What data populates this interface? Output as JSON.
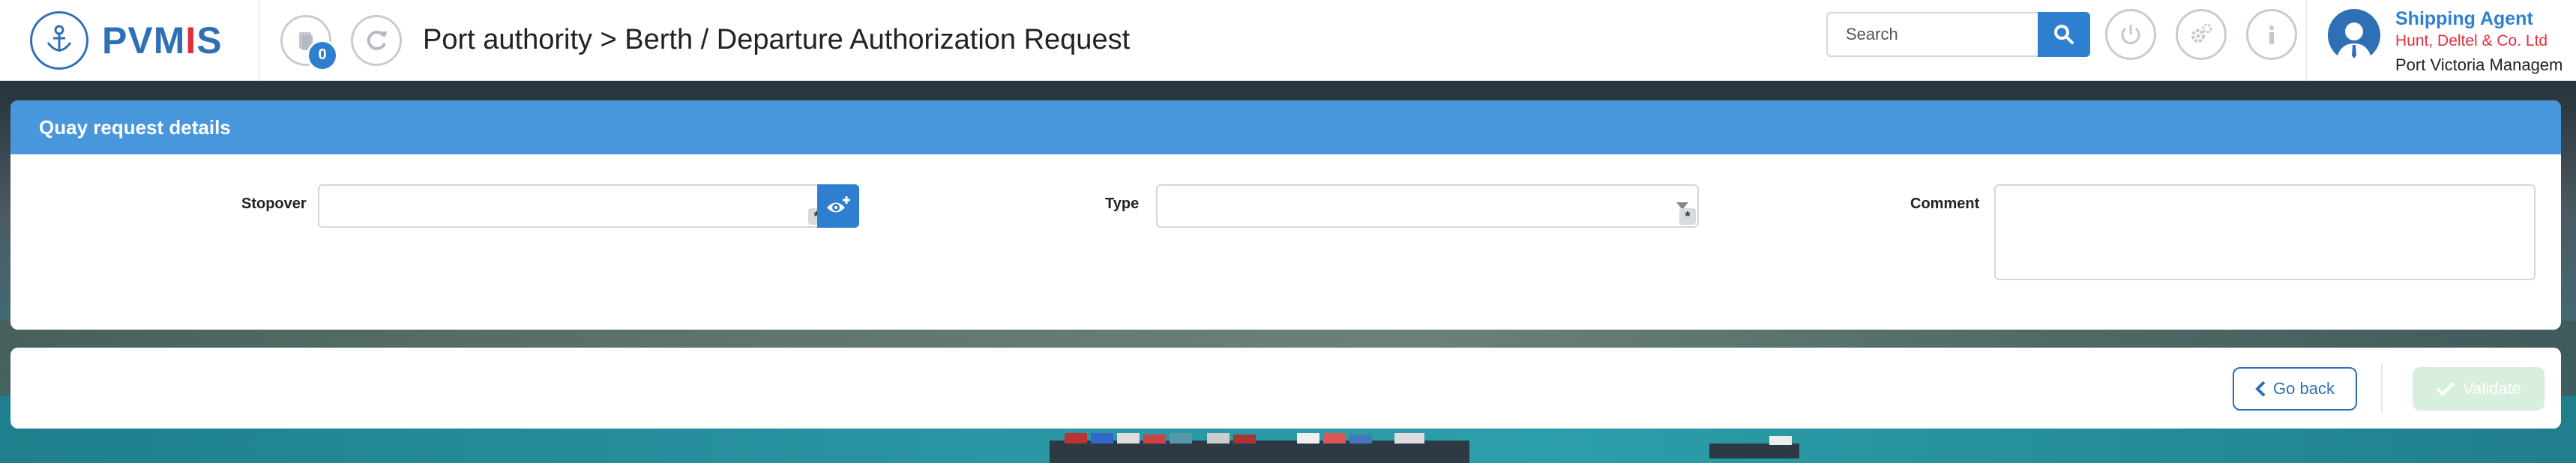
{
  "app": {
    "logo_text_a": "PVM",
    "logo_text_b": "I",
    "logo_text_c": "S",
    "notification_count": "0"
  },
  "header": {
    "title": "Port authority > Berth / Departure Authorization Request",
    "search_placeholder": "Search",
    "search_value": ""
  },
  "user": {
    "role": "Shipping Agent",
    "company": "Hunt, Deltel & Co. Ltd",
    "organization": "Port Victoria Managem"
  },
  "form": {
    "panel_title": "Quay request details",
    "stopover_label": "Stopover",
    "stopover_value": "",
    "type_label": "Type",
    "type_value": "",
    "comment_label": "Comment",
    "comment_value": "",
    "required_marker": "*"
  },
  "actions": {
    "back_label": "Go back",
    "validate_label": "Validate"
  },
  "colors": {
    "brand_blue": "#2f6fb5",
    "accent_blue": "#2f7fd0",
    "panel_header": "#4897dc",
    "brand_red": "#e0303b",
    "validate_disabled": "#d9efdd"
  },
  "icons": {
    "logo": "port-logo-icon",
    "documents": "documents-icon",
    "refresh": "refresh-icon",
    "search": "search-icon",
    "power": "power-icon",
    "settings": "gears-icon",
    "info": "info-icon",
    "avatar": "user-avatar-icon",
    "stopover_lookup": "eye-plus-icon",
    "dropdown": "caret-down-icon",
    "back": "chevron-left-icon",
    "validate": "check-icon"
  }
}
